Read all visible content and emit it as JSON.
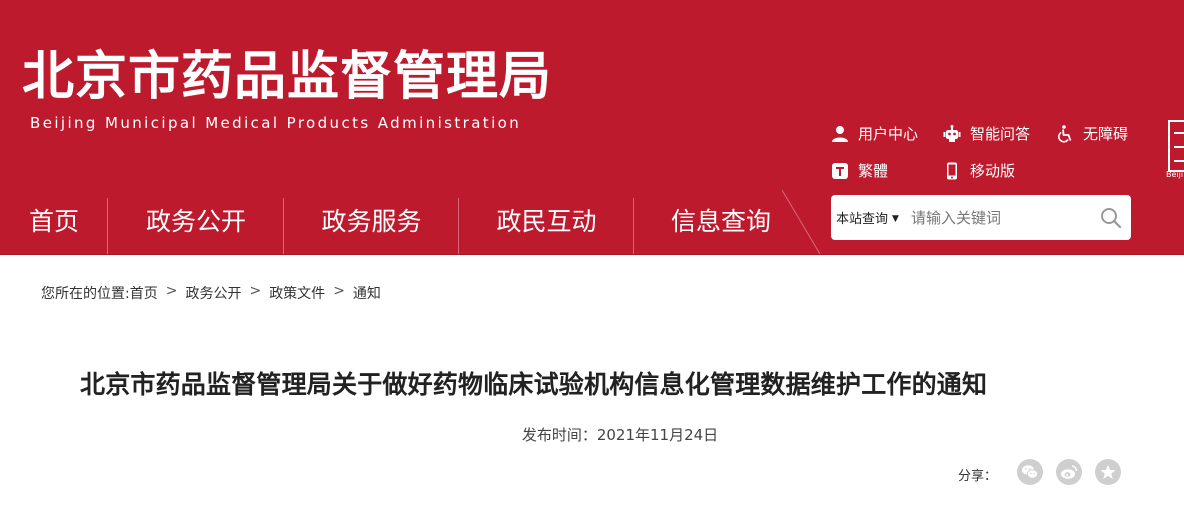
{
  "header": {
    "title": "北京市药品监督管理局",
    "subtitle": "Beijing Municipal Medical Products Administration",
    "seal_caption": "Beiji"
  },
  "utility_links": [
    {
      "label": "用户中心",
      "icon": "user-icon"
    },
    {
      "label": "智能问答",
      "icon": "robot-icon"
    },
    {
      "label": "无障碍",
      "icon": "wheelchair-icon"
    },
    {
      "label": "繁體",
      "icon": "traditional-t-icon"
    },
    {
      "label": "移动版",
      "icon": "mobile-icon"
    }
  ],
  "nav": [
    {
      "label": "首页"
    },
    {
      "label": "政务公开"
    },
    {
      "label": "政务服务"
    },
    {
      "label": "政民互动"
    },
    {
      "label": "信息查询"
    }
  ],
  "search": {
    "scope": "本站查询",
    "placeholder": "请输入关键词"
  },
  "breadcrumb": {
    "prefix": "您所在的位置:",
    "items": [
      "首页",
      "政务公开",
      "政策文件",
      "通知"
    ],
    "separator": ">"
  },
  "article": {
    "title": "北京市药品监督管理局关于做好药物临床试验机构信息化管理数据维护工作的通知",
    "date_label": "发布时间：2021年11月24日"
  },
  "share": {
    "label": "分享："
  },
  "colors": {
    "brand_red": "#be1a2e",
    "share_gray": "#cfcfcf"
  }
}
